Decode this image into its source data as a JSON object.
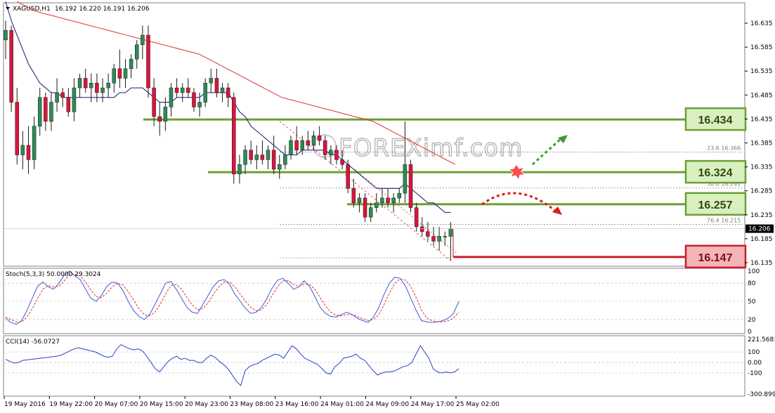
{
  "header": {
    "symbol": "XAGUSD,H1",
    "ohlc": "16.192 16.220 16.191 16.206"
  },
  "indicators": {
    "stoch_label": "Stoch(5,3,3) 50.0000 29.3024",
    "cci_label": "CCI(14) -56.0727"
  },
  "watermark": "FOREXimf.com",
  "colors": {
    "bull": "#2e8b57",
    "bear": "#dc143c",
    "ma_fast": "#191970",
    "ma_slow": "#e03030",
    "level_green": "#6aa033",
    "level_red": "#c81e2a",
    "box_green_fill": "#d9efbf",
    "box_red_fill": "#f4b4b8",
    "stoch_main": "#3b5bdb",
    "stoch_signal": "#e03030",
    "cci_line": "#2b3fc9",
    "grid": "#c8c8c8"
  },
  "chart_data": {
    "type": "candlestick",
    "y_range": [
      16.11,
      16.68
    ],
    "price_ticks": [
      "16.635",
      "16.585",
      "16.535",
      "16.485",
      "16.435",
      "16.385",
      "16.335",
      "16.285",
      "16.235",
      "16.185",
      "16.135"
    ],
    "current_price": "16.206",
    "x_labels": [
      "19 May 2016",
      "19 May 22:00",
      "20 May 07:00",
      "20 May 15:00",
      "20 May 23:00",
      "23 May 08:00",
      "23 May 16:00",
      "24 May 01:00",
      "24 May 09:00",
      "24 May 17:00",
      "25 May 02:00"
    ],
    "candles": [
      [
        16.6,
        16.64,
        16.56,
        16.62
      ],
      [
        16.62,
        16.63,
        16.45,
        16.47
      ],
      [
        16.47,
        16.5,
        16.34,
        16.36
      ],
      [
        16.36,
        16.41,
        16.33,
        16.38
      ],
      [
        16.38,
        16.42,
        16.32,
        16.35
      ],
      [
        16.35,
        16.44,
        16.33,
        16.42
      ],
      [
        16.42,
        16.5,
        16.4,
        16.48
      ],
      [
        16.48,
        16.49,
        16.41,
        16.43
      ],
      [
        16.43,
        16.49,
        16.41,
        16.47
      ],
      [
        16.47,
        16.52,
        16.45,
        16.49
      ],
      [
        16.49,
        16.5,
        16.46,
        16.48
      ],
      [
        16.48,
        16.5,
        16.44,
        16.45
      ],
      [
        16.45,
        16.52,
        16.43,
        16.5
      ],
      [
        16.5,
        16.53,
        16.48,
        16.52
      ],
      [
        16.52,
        16.54,
        16.49,
        16.5
      ],
      [
        16.5,
        16.53,
        16.47,
        16.51
      ],
      [
        16.51,
        16.53,
        16.47,
        16.49
      ],
      [
        16.49,
        16.52,
        16.47,
        16.5
      ],
      [
        16.5,
        16.53,
        16.48,
        16.51
      ],
      [
        16.51,
        16.55,
        16.49,
        16.54
      ],
      [
        16.54,
        16.58,
        16.5,
        16.52
      ],
      [
        16.52,
        16.56,
        16.5,
        16.54
      ],
      [
        16.54,
        16.57,
        16.52,
        16.56
      ],
      [
        16.56,
        16.6,
        16.54,
        16.59
      ],
      [
        16.59,
        16.63,
        16.56,
        16.61
      ],
      [
        16.61,
        16.63,
        16.48,
        16.5
      ],
      [
        16.5,
        16.52,
        16.42,
        16.44
      ],
      [
        16.44,
        16.47,
        16.4,
        16.43
      ],
      [
        16.43,
        16.48,
        16.41,
        16.46
      ],
      [
        16.46,
        16.51,
        16.44,
        16.5
      ],
      [
        16.5,
        16.52,
        16.48,
        16.49
      ],
      [
        16.49,
        16.51,
        16.47,
        16.5
      ],
      [
        16.5,
        16.52,
        16.48,
        16.49
      ],
      [
        16.49,
        16.5,
        16.45,
        16.46
      ],
      [
        16.46,
        16.49,
        16.44,
        16.47
      ],
      [
        16.47,
        16.52,
        16.46,
        16.51
      ],
      [
        16.51,
        16.54,
        16.49,
        16.52
      ],
      [
        16.52,
        16.54,
        16.48,
        16.49
      ],
      [
        16.49,
        16.51,
        16.47,
        16.5
      ],
      [
        16.5,
        16.51,
        16.46,
        16.48
      ],
      [
        16.48,
        16.49,
        16.3,
        16.32
      ],
      [
        16.32,
        16.36,
        16.3,
        16.34
      ],
      [
        16.34,
        16.38,
        16.32,
        16.37
      ],
      [
        16.37,
        16.39,
        16.34,
        16.35
      ],
      [
        16.35,
        16.38,
        16.33,
        16.36
      ],
      [
        16.36,
        16.39,
        16.34,
        16.35
      ],
      [
        16.35,
        16.38,
        16.33,
        16.37
      ],
      [
        16.37,
        16.4,
        16.32,
        16.33
      ],
      [
        16.33,
        16.36,
        16.31,
        16.34
      ],
      [
        16.34,
        16.38,
        16.33,
        16.36
      ],
      [
        16.36,
        16.4,
        16.35,
        16.39
      ],
      [
        16.39,
        16.42,
        16.36,
        16.37
      ],
      [
        16.37,
        16.4,
        16.36,
        16.39
      ],
      [
        16.39,
        16.41,
        16.37,
        16.38
      ],
      [
        16.38,
        16.41,
        16.37,
        16.4
      ],
      [
        16.4,
        16.42,
        16.38,
        16.39
      ],
      [
        16.39,
        16.4,
        16.35,
        16.36
      ],
      [
        16.36,
        16.38,
        16.34,
        16.37
      ],
      [
        16.37,
        16.38,
        16.34,
        16.35
      ],
      [
        16.35,
        16.37,
        16.33,
        16.34
      ],
      [
        16.34,
        16.35,
        16.28,
        16.29
      ],
      [
        16.29,
        16.31,
        16.25,
        16.26
      ],
      [
        16.26,
        16.28,
        16.24,
        16.27
      ],
      [
        16.27,
        16.28,
        16.22,
        16.23
      ],
      [
        16.23,
        16.26,
        16.22,
        16.25
      ],
      [
        16.25,
        16.28,
        16.24,
        16.26
      ],
      [
        16.26,
        16.29,
        16.25,
        16.27
      ],
      [
        16.27,
        16.29,
        16.25,
        16.26
      ],
      [
        16.26,
        16.28,
        16.24,
        16.27
      ],
      [
        16.27,
        16.29,
        16.26,
        16.28
      ],
      [
        16.28,
        16.43,
        16.26,
        16.34
      ],
      [
        16.34,
        16.35,
        16.24,
        16.25
      ],
      [
        16.25,
        16.26,
        16.2,
        16.21
      ],
      [
        16.21,
        16.23,
        16.19,
        16.2
      ],
      [
        16.2,
        16.22,
        16.18,
        16.19
      ],
      [
        16.19,
        16.21,
        16.17,
        16.18
      ],
      [
        16.18,
        16.21,
        16.16,
        16.19
      ],
      [
        16.19,
        16.2,
        16.17,
        16.19
      ],
      [
        16.19,
        16.22,
        16.14,
        16.206
      ]
    ],
    "ma_fast_values": [
      16.68,
      16.64,
      16.61,
      16.58,
      16.55,
      16.53,
      16.51,
      16.5,
      16.49,
      16.49,
      16.48,
      16.48,
      16.48,
      16.48,
      16.48,
      16.48,
      16.48,
      16.48,
      16.48,
      16.48,
      16.49,
      16.49,
      16.5,
      16.5,
      16.5,
      16.49,
      16.48,
      16.47,
      16.47,
      16.47,
      16.48,
      16.48,
      16.48,
      16.48,
      16.48,
      16.49,
      16.49,
      16.49,
      16.49,
      16.49,
      16.47,
      16.45,
      16.44,
      16.42,
      16.41,
      16.4,
      16.39,
      16.38,
      16.37,
      16.36,
      16.36,
      16.36,
      16.37,
      16.37,
      16.37,
      16.37,
      16.37,
      16.36,
      16.36,
      16.35,
      16.34,
      16.33,
      16.32,
      16.31,
      16.3,
      16.29,
      16.29,
      16.29,
      16.29,
      16.29,
      16.3,
      16.29,
      16.28,
      16.27,
      16.26,
      16.26,
      16.25,
      16.24,
      16.24
    ],
    "ma_slow_start_index": 30,
    "ma_slow_values": [
      16.65,
      16.6,
      16.57,
      16.55,
      16.52,
      16.5,
      16.49,
      16.48,
      16.47,
      16.46,
      16.45,
      16.44,
      16.43,
      16.42,
      16.41,
      16.4,
      16.39,
      16.38,
      16.36,
      16.34,
      16.32
    ],
    "levels": [
      {
        "label": "16.434",
        "price": 16.434,
        "color": "red_green",
        "kind": "green"
      },
      {
        "label": "16.324",
        "price": 16.324,
        "kind": "green"
      },
      {
        "label": "16.257",
        "price": 16.257,
        "kind": "green"
      },
      {
        "label": "16.147",
        "price": 16.147,
        "kind": "red"
      }
    ],
    "fibonacci": [
      {
        "label": "23.6  16.366",
        "price": 16.366
      },
      {
        "label": "50.0  16.291",
        "price": 16.291
      },
      {
        "label": "76.4  16.215",
        "price": 16.215
      }
    ],
    "stoch_ticks": [
      "100",
      "80",
      "50",
      "20",
      "0"
    ],
    "stoch_main": [
      22,
      15,
      12,
      18,
      35,
      55,
      75,
      82,
      74,
      70,
      80,
      93,
      100,
      92,
      86,
      70,
      55,
      50,
      60,
      75,
      82,
      80,
      68,
      50,
      35,
      25,
      20,
      28,
      45,
      62,
      80,
      83,
      70,
      55,
      40,
      32,
      30,
      45,
      60,
      75,
      84,
      86,
      78,
      62,
      50,
      38,
      30,
      32,
      40,
      55,
      72,
      85,
      88,
      80,
      70,
      74,
      84,
      75,
      58,
      40,
      30,
      25,
      24,
      28,
      32,
      28,
      22,
      18,
      15,
      24,
      40,
      62,
      80,
      90,
      88,
      75,
      55,
      35,
      18,
      16,
      15,
      16,
      18,
      22,
      30,
      50
    ],
    "stoch_signal": [
      24,
      20,
      16,
      16,
      24,
      38,
      55,
      70,
      76,
      74,
      75,
      84,
      94,
      95,
      92,
      82,
      68,
      58,
      56,
      64,
      74,
      80,
      77,
      66,
      52,
      38,
      28,
      26,
      32,
      45,
      62,
      76,
      78,
      70,
      56,
      44,
      36,
      38,
      48,
      62,
      74,
      82,
      82,
      74,
      62,
      50,
      40,
      34,
      36,
      45,
      60,
      74,
      84,
      84,
      78,
      75,
      78,
      78,
      70,
      56,
      42,
      32,
      27,
      26,
      28,
      28,
      25,
      21,
      18,
      20,
      28,
      45,
      64,
      80,
      87,
      85,
      74,
      56,
      36,
      22,
      18,
      16,
      16,
      18,
      22,
      32
    ],
    "cci_ticks": [
      "221.5681",
      "100",
      "0.00",
      "-100",
      "-300.899"
    ],
    "cci": [
      30,
      10,
      -5,
      0,
      20,
      25,
      30,
      35,
      40,
      45,
      50,
      55,
      60,
      70,
      90,
      110,
      130,
      140,
      130,
      120,
      110,
      100,
      80,
      60,
      50,
      60,
      130,
      170,
      150,
      130,
      120,
      130,
      110,
      60,
      0,
      -60,
      -90,
      -40,
      10,
      40,
      60,
      30,
      40,
      20,
      20,
      0,
      0,
      40,
      70,
      50,
      10,
      -20,
      -60,
      -120,
      -180,
      -220,
      -80,
      -40,
      -20,
      -10,
      20,
      40,
      60,
      80,
      70,
      40,
      100,
      160,
      130,
      80,
      40,
      20,
      0,
      -20,
      -60,
      -100,
      -110,
      -40,
      -10,
      40,
      50,
      60,
      80,
      40,
      20,
      -30,
      -80,
      -120,
      -100,
      -90,
      -90,
      -80,
      -60,
      -40,
      -30,
      0,
      80,
      160,
      100,
      40,
      -60,
      -90,
      -100,
      -90,
      -100,
      -90,
      -60
    ]
  }
}
